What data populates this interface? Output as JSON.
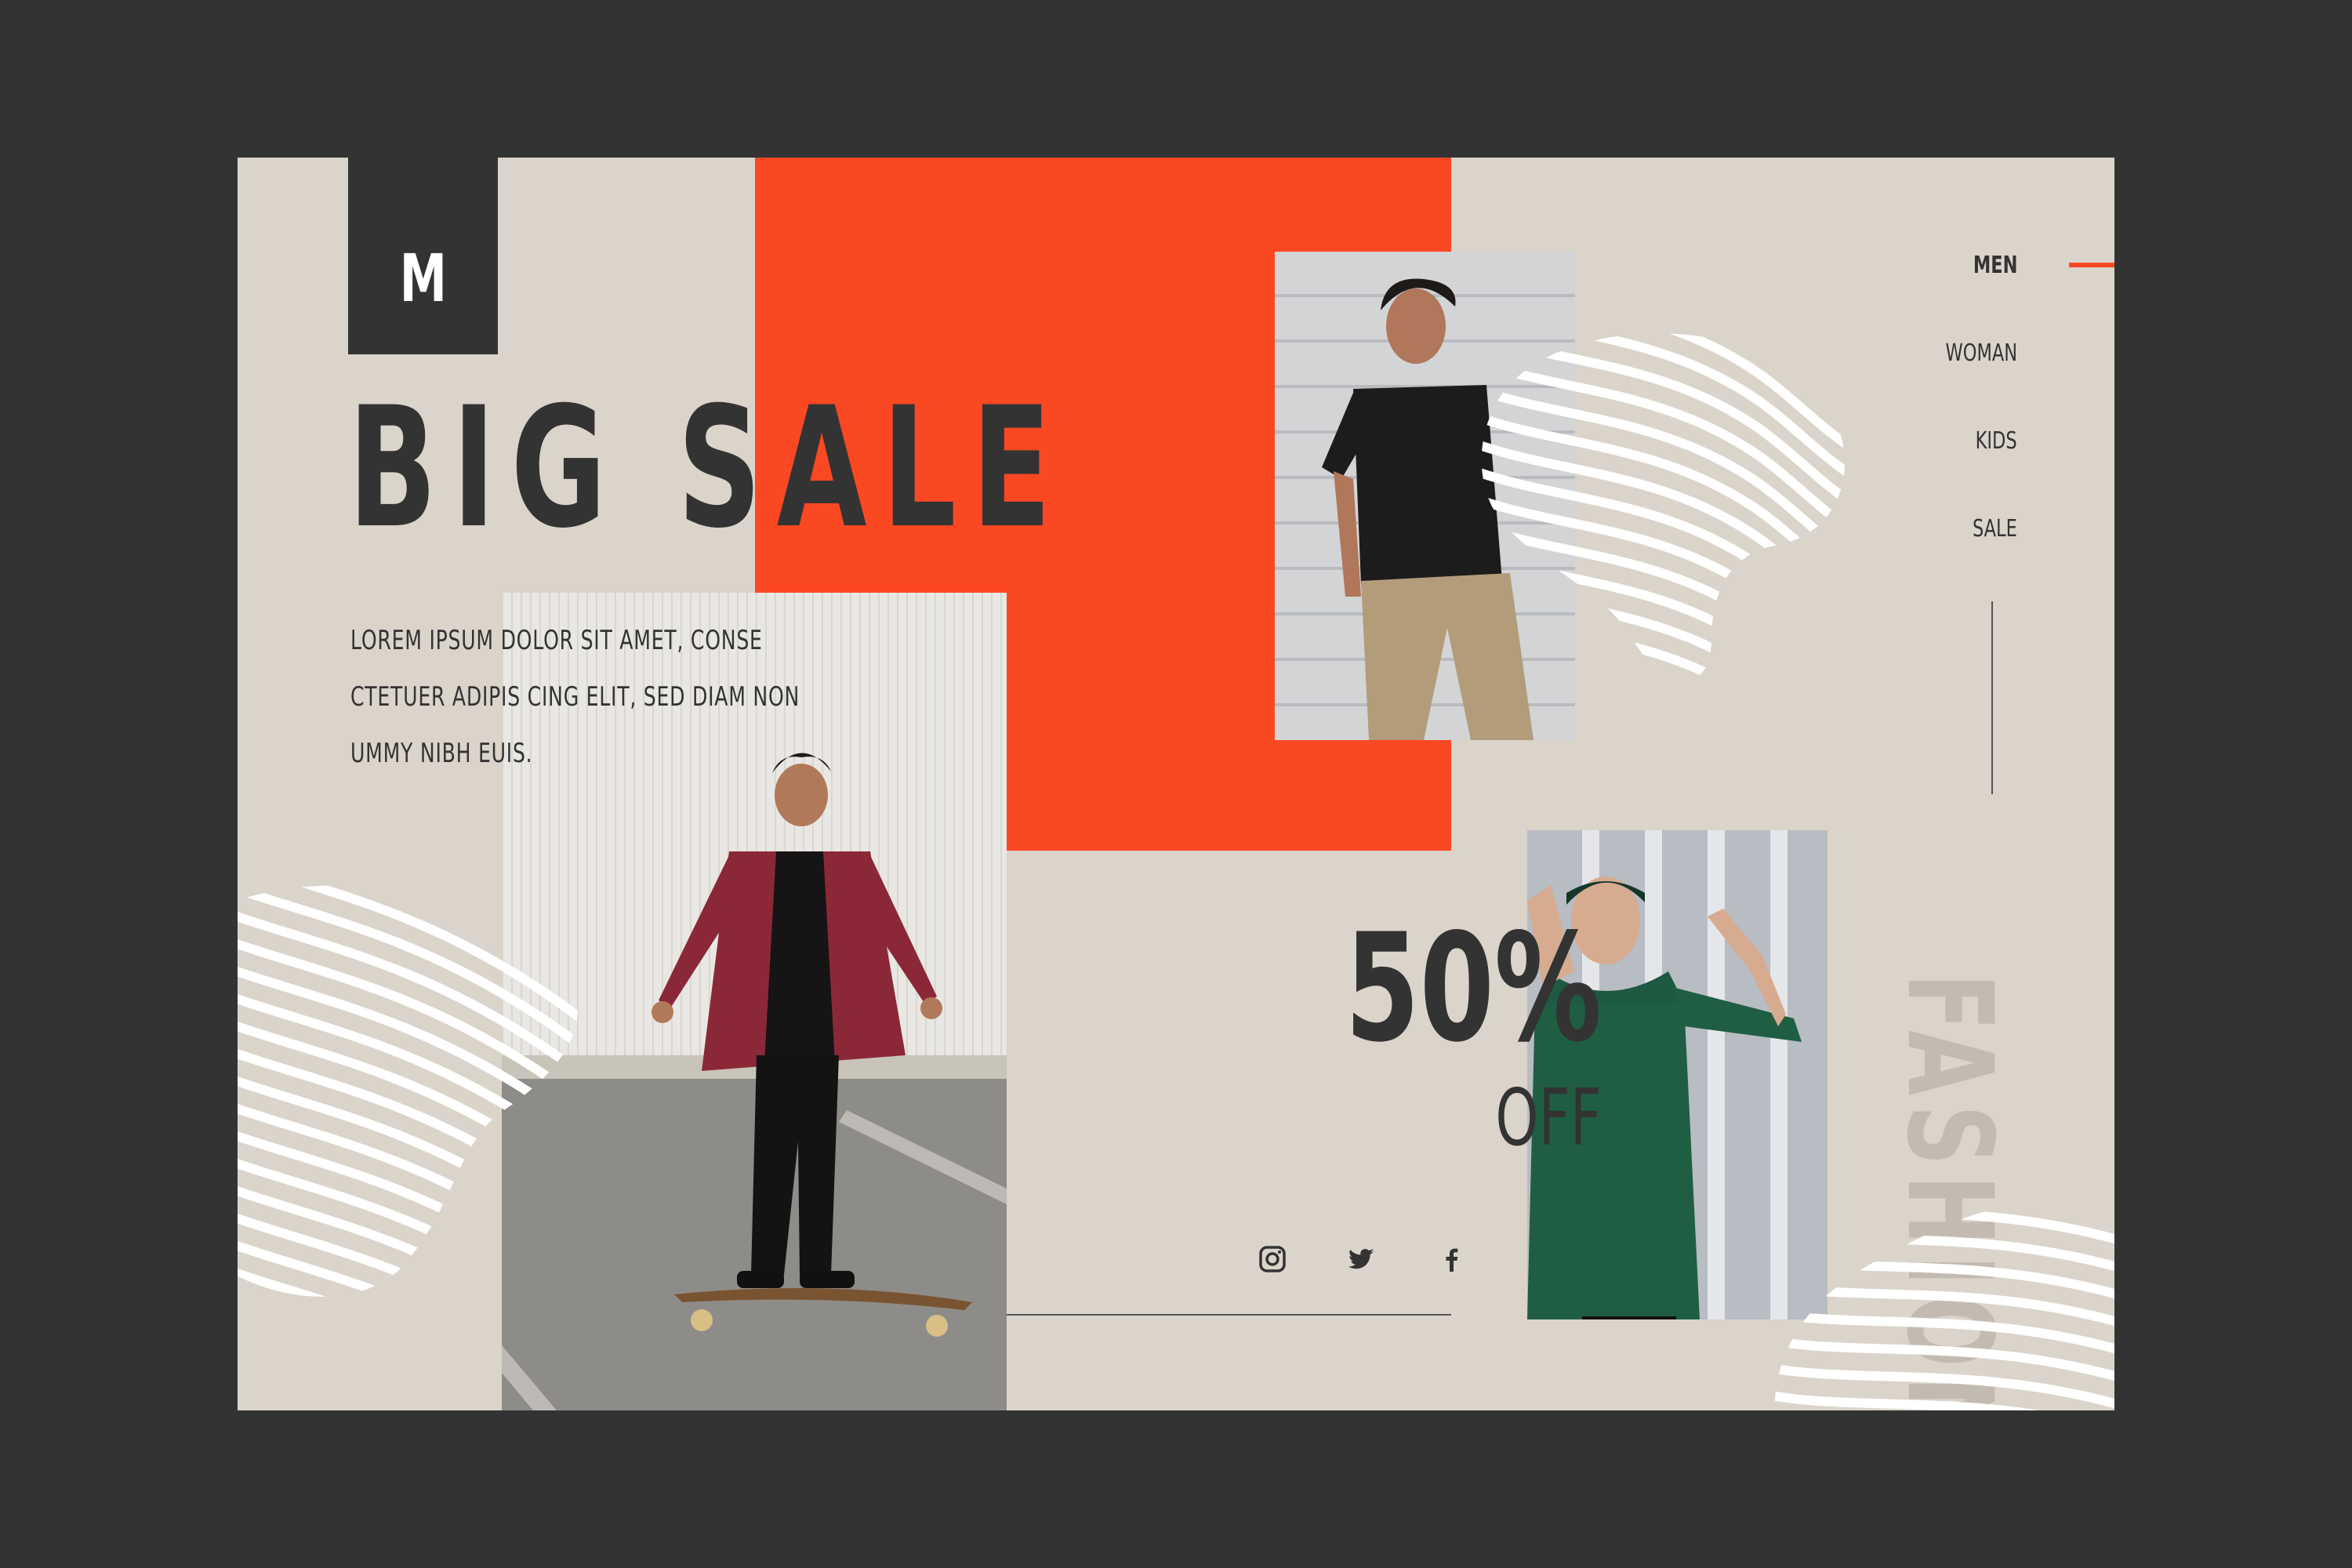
{
  "brand": {
    "logo_letter": "M"
  },
  "hero": {
    "headline": "BIG SALE",
    "description_lines": [
      "LOREM IPSUM DOLOR SIT AMET, CONSE",
      "CTETUER ADIPIS CING ELIT, SED DIAM NON",
      "UMMY NIBH EUIS."
    ]
  },
  "promo": {
    "discount": "50%",
    "off_label": "OFF"
  },
  "nav": {
    "items": [
      {
        "label": "MEN",
        "active": true
      },
      {
        "label": "WOMAN",
        "active": false
      },
      {
        "label": "KIDS",
        "active": false
      },
      {
        "label": "SALE",
        "active": false
      }
    ]
  },
  "vertical_text": "FASHION",
  "social": {
    "icons": [
      "instagram-icon",
      "twitter-icon",
      "facebook-icon"
    ]
  },
  "colors": {
    "background": "#dad4cb",
    "accent": "#fa4823",
    "dark": "#333333",
    "frame": "#333333"
  }
}
